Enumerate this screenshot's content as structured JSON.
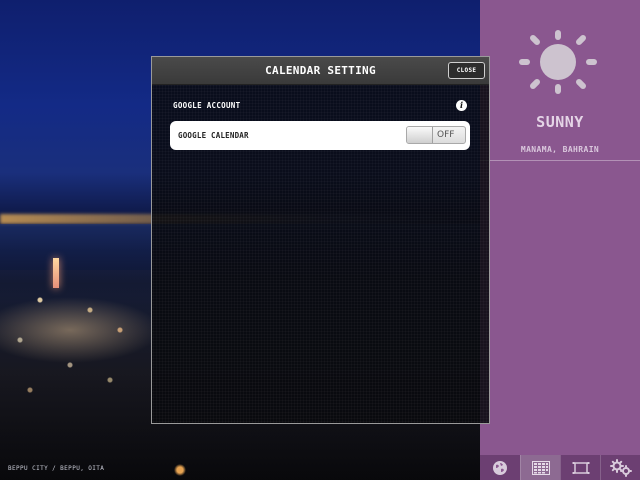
{
  "background": {
    "caption": "BEPPU CITY / BEPPU, OITA"
  },
  "weather": {
    "condition": "SUNNY",
    "location": "MANAMA, BAHRAIN",
    "icon": "sun-icon",
    "panel_color": "#8a578f"
  },
  "toolbar": {
    "items": [
      {
        "icon": "globe-icon",
        "active": false
      },
      {
        "icon": "calendar-icon",
        "active": true
      },
      {
        "icon": "film-icon",
        "active": false
      },
      {
        "icon": "settings-gears-icon",
        "active": false
      }
    ]
  },
  "dialog": {
    "title": "CALENDAR SETTING",
    "close_label": "CLOSE",
    "section_label": "GOOGLE ACCOUNT",
    "info_glyph": "i",
    "settings": [
      {
        "label": "GOOGLE CALENDAR",
        "toggle_state": "OFF"
      }
    ]
  }
}
